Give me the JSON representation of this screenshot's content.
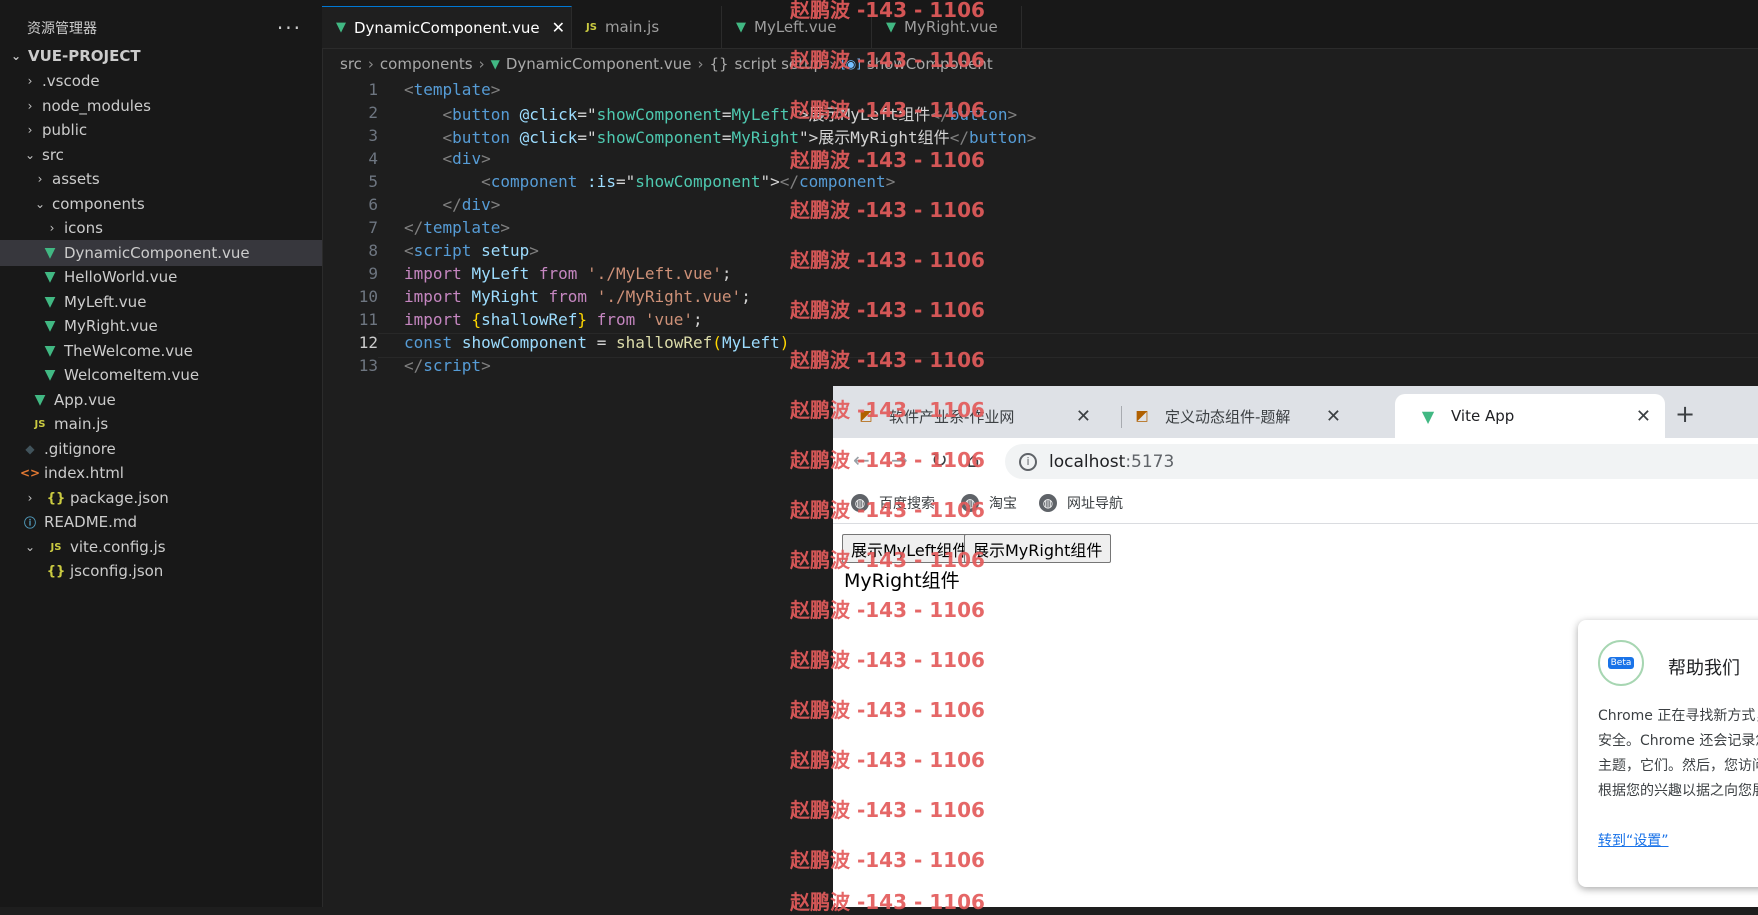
{
  "explorer": {
    "title": "资源管理器",
    "more": "···",
    "project": "VUE-PROJECT",
    "items": [
      {
        "label": ".vscode"
      },
      {
        "label": "node_modules"
      },
      {
        "label": "public"
      },
      {
        "label": "src"
      },
      {
        "label": "assets"
      },
      {
        "label": "components"
      },
      {
        "label": "icons"
      },
      {
        "label": "DynamicComponent.vue"
      },
      {
        "label": "HelloWorld.vue"
      },
      {
        "label": "MyLeft.vue"
      },
      {
        "label": "MyRight.vue"
      },
      {
        "label": "TheWelcome.vue"
      },
      {
        "label": "WelcomeItem.vue"
      },
      {
        "label": "App.vue"
      },
      {
        "label": "main.js"
      },
      {
        "label": ".gitignore"
      },
      {
        "label": "index.html"
      },
      {
        "label": "package.json"
      },
      {
        "label": "README.md"
      },
      {
        "label": "vite.config.js"
      },
      {
        "label": "jsconfig.json"
      }
    ]
  },
  "editor": {
    "tabs": [
      {
        "label": "DynamicComponent.vue"
      },
      {
        "label": "main.js"
      },
      {
        "label": "MyLeft.vue"
      },
      {
        "label": "MyRight.vue"
      }
    ],
    "breadcrumb": [
      "src",
      "components",
      "DynamicComponent.vue",
      "script setup",
      "showComponent"
    ],
    "line_numbers": [
      "1",
      "2",
      "3",
      "4",
      "5",
      "6",
      "7",
      "8",
      "9",
      "10",
      "11",
      "12",
      "13"
    ],
    "code": {
      "l1": [
        "<",
        "template",
        ">"
      ],
      "l2": [
        "<",
        "button",
        "@click",
        "=\"",
        "showComponent",
        "=",
        "MyLeft",
        "\">",
        "展示MyLeft组件",
        "</",
        "button",
        ">"
      ],
      "l3": [
        "<",
        "button",
        "@click",
        "=\"",
        "showComponent",
        "=",
        "MyRight",
        "\">",
        "展示MyRight组件",
        "</",
        "button",
        ">"
      ],
      "l4": [
        "<",
        "div",
        ">"
      ],
      "l5": [
        "<",
        "component",
        ":is",
        "=\"",
        "showComponent",
        "\">",
        "</",
        "component",
        ">"
      ],
      "l6": [
        "</",
        "div",
        ">"
      ],
      "l7": [
        "</",
        "template",
        ">"
      ],
      "l8": [
        "<",
        "script",
        "setup",
        ">"
      ],
      "l9": [
        "import",
        "MyLeft",
        "from",
        "'./MyLeft.vue'",
        ";"
      ],
      "l10": [
        "import",
        "MyRight",
        "from",
        "'./MyRight.vue'",
        ";"
      ],
      "l11": [
        "import",
        "{",
        "shallowRef",
        "}",
        "from",
        "'vue'",
        ";"
      ],
      "l12": [
        "const",
        "showComponent",
        "=",
        "shallowRef",
        "(",
        "MyLeft",
        ")"
      ],
      "l13": [
        "</",
        "script",
        ">"
      ]
    }
  },
  "browser": {
    "tabs": [
      {
        "label": "软件产业系-作业网"
      },
      {
        "label": "定义动态组件-题解"
      },
      {
        "label": "Vite App"
      }
    ],
    "new_tab": "+",
    "url_host": "localhost",
    "url_port": ":5173",
    "bookmarks": [
      "百度搜索",
      "淘宝",
      "网址导航"
    ],
    "page": {
      "buttons": [
        "展示MyLeft组件",
        "展示MyRight组件"
      ],
      "text": "MyRight组件"
    },
    "popup": {
      "title": "帮助我们",
      "badge": "Beta",
      "body": "Chrome 正在寻找新方式，让网络更安全。Chrome 还会记录您感兴趣的主题，它们。然后，您访问的网站可以根据您的兴趣以据之向您展示广告",
      "link": "转到“设置”"
    }
  },
  "watermark": "赵鹏波 -143 - 1106",
  "colors": {
    "vue_green": "#41b883",
    "accent": "#0078d4",
    "watermark": "#e35b5b"
  }
}
